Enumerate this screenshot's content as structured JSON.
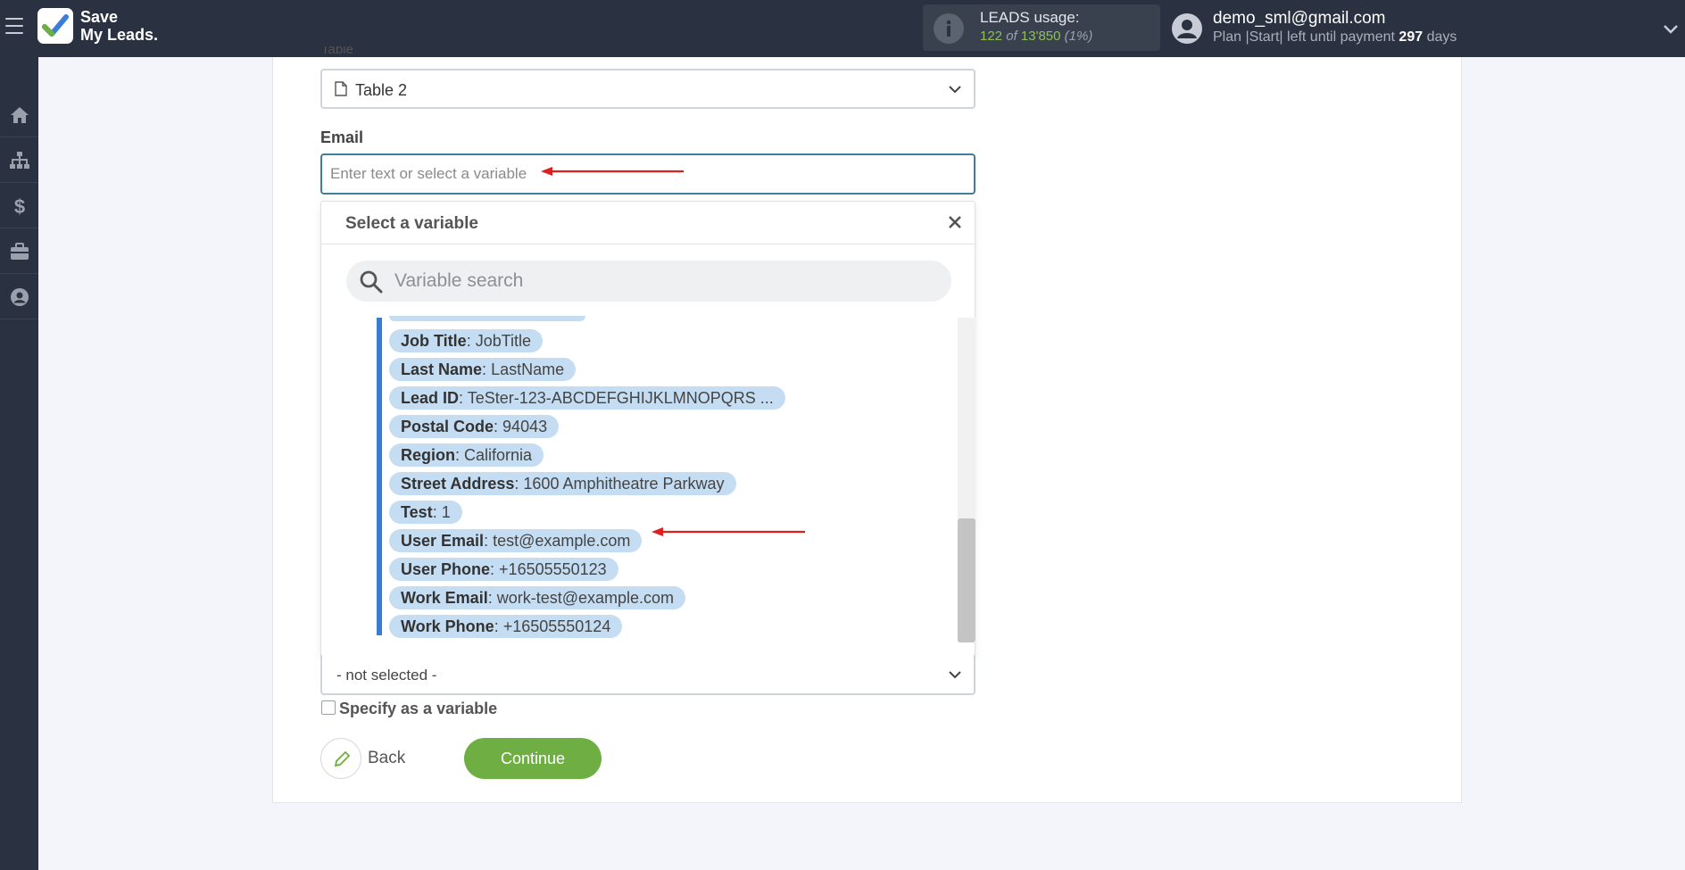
{
  "app": {
    "logo_line1": "Save",
    "logo_line2": "My Leads."
  },
  "usage": {
    "title": "LEADS usage:",
    "used": "122",
    "of_label": "of",
    "total": "13'850",
    "percent": "(1%)"
  },
  "account": {
    "email": "demo_sml@gmail.com",
    "plan_prefix": "Plan |Start| left until payment",
    "days": "297",
    "days_suffix": "days"
  },
  "sidebar": {
    "items": [
      "home-icon",
      "sitemap-icon",
      "dollar-icon",
      "briefcase-icon",
      "user-circle-icon"
    ]
  },
  "form": {
    "table_label": "Table",
    "table_value": "Table 2",
    "email_label": "Email",
    "email_placeholder": "Enter text or select a variable",
    "email_value": ""
  },
  "variable_panel": {
    "title": "Select a variable",
    "search_placeholder": "Variable search",
    "items": [
      {
        "key": "Job Title",
        "value": "JobTitle"
      },
      {
        "key": "Last Name",
        "value": "LastName"
      },
      {
        "key": "Lead ID",
        "value": "TeSter-123-ABCDEFGHIJKLMNOPQRS ..."
      },
      {
        "key": "Postal Code",
        "value": "94043"
      },
      {
        "key": "Region",
        "value": "California"
      },
      {
        "key": "Street Address",
        "value": "1600 Amphitheatre Parkway"
      },
      {
        "key": "Test",
        "value": "1"
      },
      {
        "key": "User Email",
        "value": "test@example.com"
      },
      {
        "key": "User Phone",
        "value": "+16505550123"
      },
      {
        "key": "Work Email",
        "value": "work-test@example.com"
      },
      {
        "key": "Work Phone",
        "value": "+16505550124"
      }
    ]
  },
  "lower": {
    "select_value": "- not selected -",
    "specify_label": "Specify as a variable",
    "back_label": "Back",
    "continue_label": "Continue"
  },
  "colors": {
    "topbar": "#2a3140",
    "accent_green": "#6fae42",
    "pill_blue": "#c5ddf3",
    "list_bar": "#3a7bd5",
    "annotation_arrow": "#e01e1e"
  }
}
